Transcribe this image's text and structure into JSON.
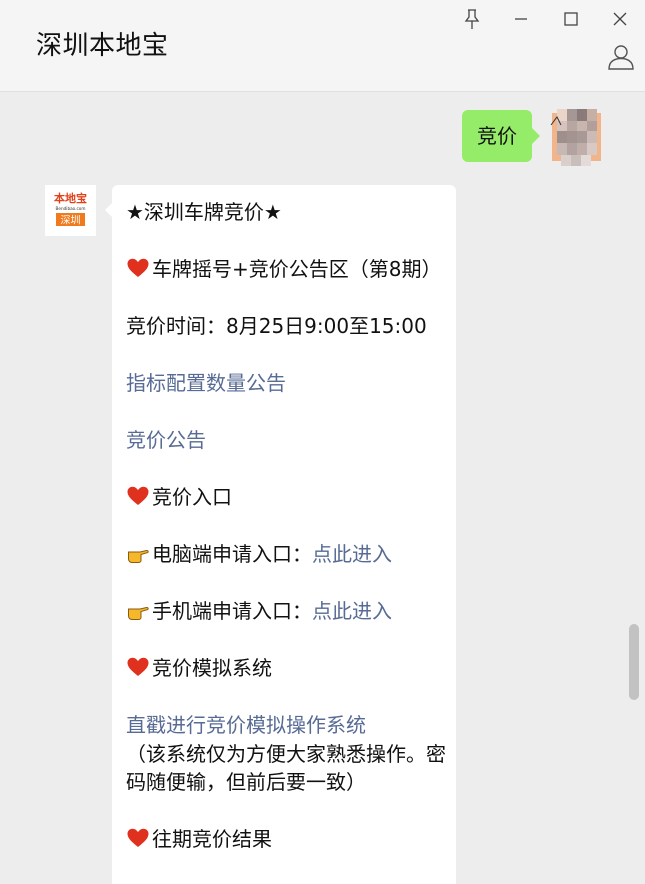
{
  "window": {
    "title": "深圳本地宝"
  },
  "chat": {
    "outgoing_message": "竞价",
    "bot_avatar": {
      "logo_text": "本地宝",
      "logo_subtext": "Bendibao.com",
      "city_tag": "深圳"
    },
    "article": {
      "heading": "★深圳车牌竞价★",
      "section_lottery": "车牌摇号+竞价公告区（第8期）",
      "auction_time": "竞价时间：8月25日9:00至15:00",
      "link_quota_notice": "指标配置数量公告",
      "link_auction_notice": "竞价公告",
      "section_entry": "竞价入口",
      "pc_entry_label": "电脑端申请入口：",
      "pc_entry_link": "点此进入",
      "mobile_entry_label": "手机端申请入口：",
      "mobile_entry_link": "点此进入",
      "section_simulation": "竞价模拟系统",
      "simulation_link": "直戳进行竞价模拟操作系统",
      "simulation_note": "（该系统仅为方便大家熟悉操作。密码随便输，但前后要一致）",
      "section_history": "往期竞价结果"
    }
  },
  "colors": {
    "outgoing_bubble": "#95ec69",
    "link": "#576b95",
    "heart": "#e0301e",
    "hand": "#f5b82a",
    "logo_orange": "#f07b1f"
  },
  "icons": [
    "pin-icon",
    "minimize-icon",
    "maximize-icon",
    "close-icon",
    "profile-icon",
    "heart-emoji-icon",
    "pointing-hand-emoji-icon"
  ]
}
